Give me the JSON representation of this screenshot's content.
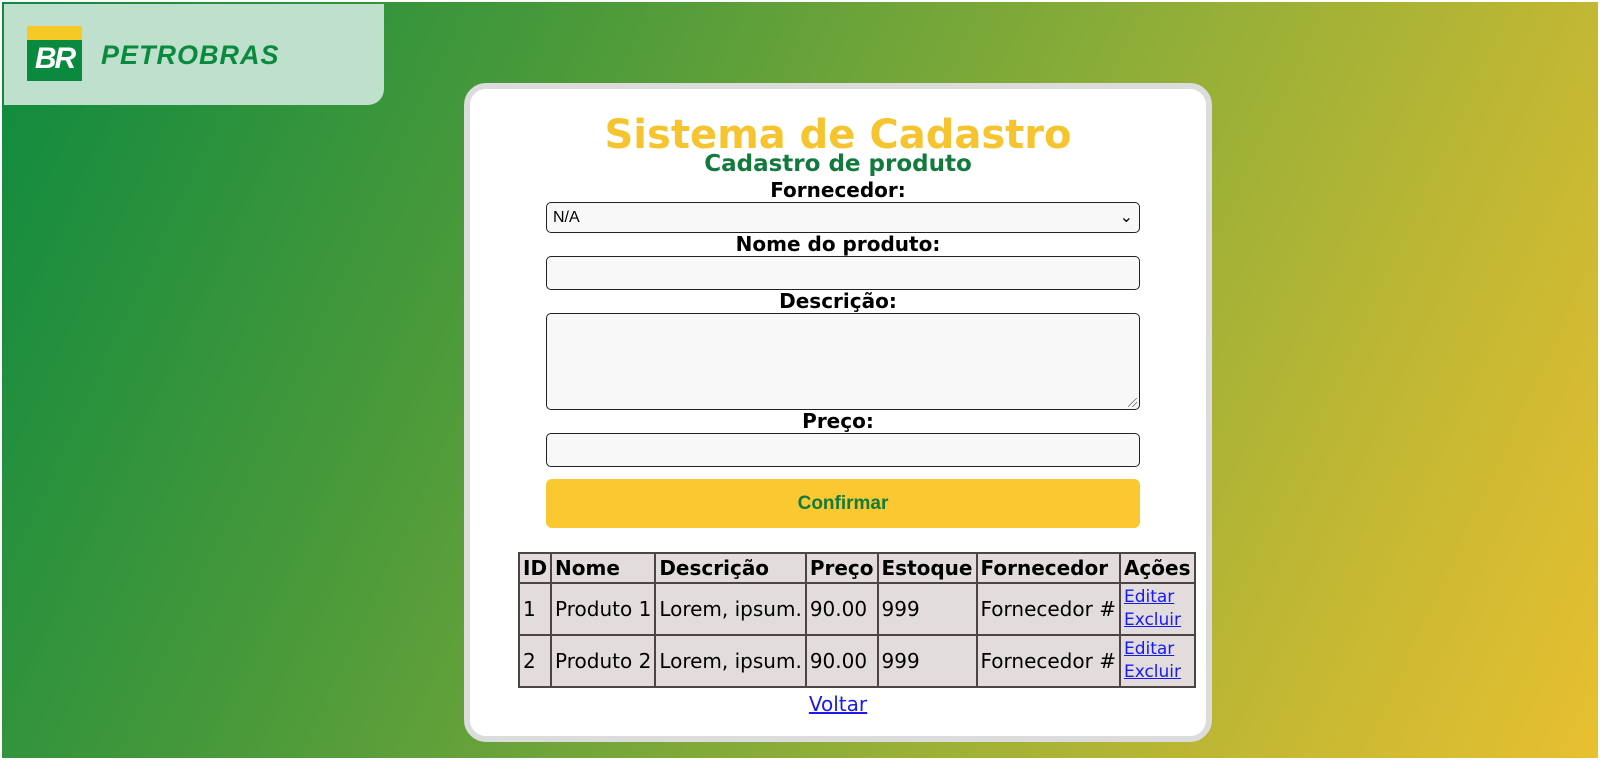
{
  "brand": {
    "mark_text": "BR",
    "name": "PETROBRAS"
  },
  "page": {
    "title": "Sistema de Cadastro",
    "subtitle": "Cadastro de produto"
  },
  "form": {
    "supplier_label": "Fornecedor:",
    "supplier_value": "N/A",
    "name_label": "Nome do produto:",
    "name_value": "",
    "description_label": "Descrição:",
    "description_value": "",
    "price_label": "Preço:",
    "price_value": "",
    "confirm_label": "Confirmar"
  },
  "table": {
    "headers": [
      "ID",
      "Nome",
      "Descrição",
      "Preço",
      "Estoque",
      "Fornecedor",
      "Ações"
    ],
    "rows": [
      {
        "id": "1",
        "name": "Produto 1",
        "description": "Lorem, ipsum.",
        "price": "90.00",
        "stock": "999",
        "supplier": "Fornecedor #",
        "edit": "Editar",
        "delete": "Excluir"
      },
      {
        "id": "2",
        "name": "Produto 2",
        "description": "Lorem, ipsum.",
        "price": "90.00",
        "stock": "999",
        "supplier": "Fornecedor #",
        "edit": "Editar",
        "delete": "Excluir"
      }
    ]
  },
  "nav": {
    "back_label": "Voltar"
  },
  "colors": {
    "title": "#f6c42e",
    "subtitle": "#137a3d",
    "button": "#fac830",
    "button_text": "#137a3d",
    "brand_green": "#0a8a3e",
    "brand_yellow": "#f7c927"
  },
  "icons": {
    "select_arrow": "chevron-down-icon",
    "textarea_resize": "resize-handle-icon"
  }
}
